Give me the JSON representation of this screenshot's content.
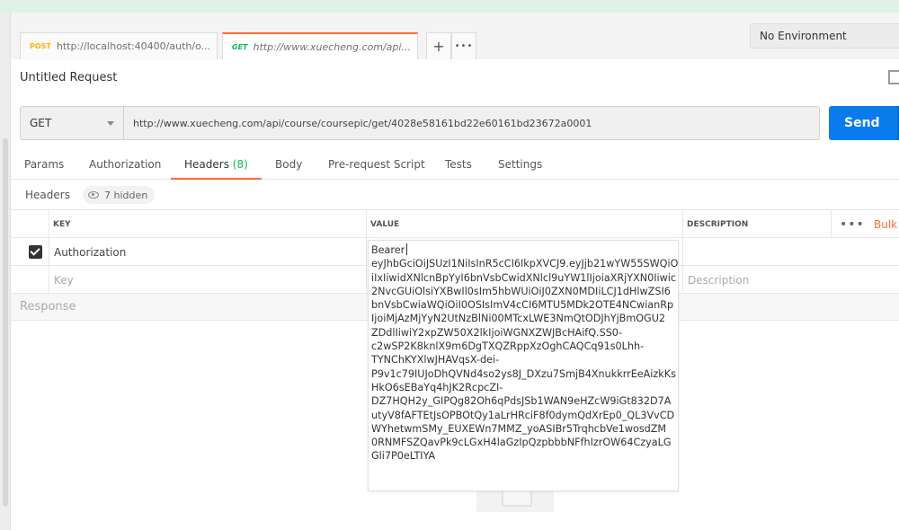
{
  "tabs": [
    {
      "method": "POST",
      "url": "http://localhost:40400/auth/o...",
      "unsaved": true
    },
    {
      "method": "GET",
      "url": "http://www.xuecheng.com/api...",
      "close": "✕"
    }
  ],
  "tab_actions": {
    "add": "+",
    "more": "•••"
  },
  "environment": {
    "selected": "No Environment"
  },
  "request": {
    "title": "Untitled Request",
    "method": "GET",
    "url": "http://www.xuecheng.com/api/course/coursepic/get/4028e58161bd22e60161bd23672a0001",
    "send_label": "Send"
  },
  "request_tabs": [
    {
      "label": "Params"
    },
    {
      "label": "Authorization"
    },
    {
      "label": "Headers",
      "count": "(8)"
    },
    {
      "label": "Body"
    },
    {
      "label": "Pre-request Script"
    },
    {
      "label": "Tests"
    },
    {
      "label": "Settings"
    }
  ],
  "headers_section": {
    "label": "Headers",
    "hidden": "7 hidden"
  },
  "table": {
    "columns": {
      "key": "KEY",
      "value": "VALUE",
      "description": "DESCRIPTION"
    },
    "more": "•••",
    "bulk_edit": "Bulk",
    "rows": [
      {
        "checked": true,
        "key": "Authorization"
      }
    ],
    "new_row": {
      "key_placeholder": "Key",
      "description_placeholder": "Description"
    }
  },
  "response": {
    "label": "Response"
  },
  "value_editor": {
    "lines": [
      "Bearer",
      "eyJhbGciOiJSUzI1NiIsInR5cCI6IkpXVCJ9.eyJjb21wYW55SWQiO",
      "iIxIiwidXNlcnBpYyI6bnVsbCwidXNlcl9uYW1lIjoiaXRjYXN0Iiwic",
      "2NvcGUiOlsiYXBwIl0sIm5hbWUiOiJ0ZXN0MDIiLCJ1dHlwZSI6",
      "bnVsbCwiaWQiOiI0OSIsImV4cCI6MTU5MDk2OTE4NCwianRp",
      "IjoiMjAzMjYyN2UtNzBlNi00MTcxLWE3NmQtODJhYjBmOGU2",
      "ZDdlIiwiY2xpZW50X2lkIjoiWGNXZWJBcHAifQ.SS0-",
      "c2wSP2K8knlX9m6DgTXQZRppXzOghCAQCq91s0Lhh-",
      "TYNChKYXlwJHAVqsX-dei-",
      "P9v1c79IUJoDhQVNd4so2ys8J_DXzu7SmjB4XnukkrrEeAizkKs",
      "HkO6sEBaYq4hJK2RcpcZI-",
      "DZ7HQH2y_GIPQg82Oh6qPdsJSb1WAN9eHZcW9iGt832D7A",
      "utyV8fAFTEtJsOPBOtQy1aLrHRciF8f0dymQdXrEp0_QL3VvCD",
      "WYhetwmSMy_EUXEWn7MMZ_yoASIBr5TrqhcbVe1wosdZM",
      "0RNMFSZQavPk9cLGxH4laGzIpQzpbbbNFfhIzrOW64CzyaLG",
      "Gli7P0eLTIYA"
    ]
  }
}
